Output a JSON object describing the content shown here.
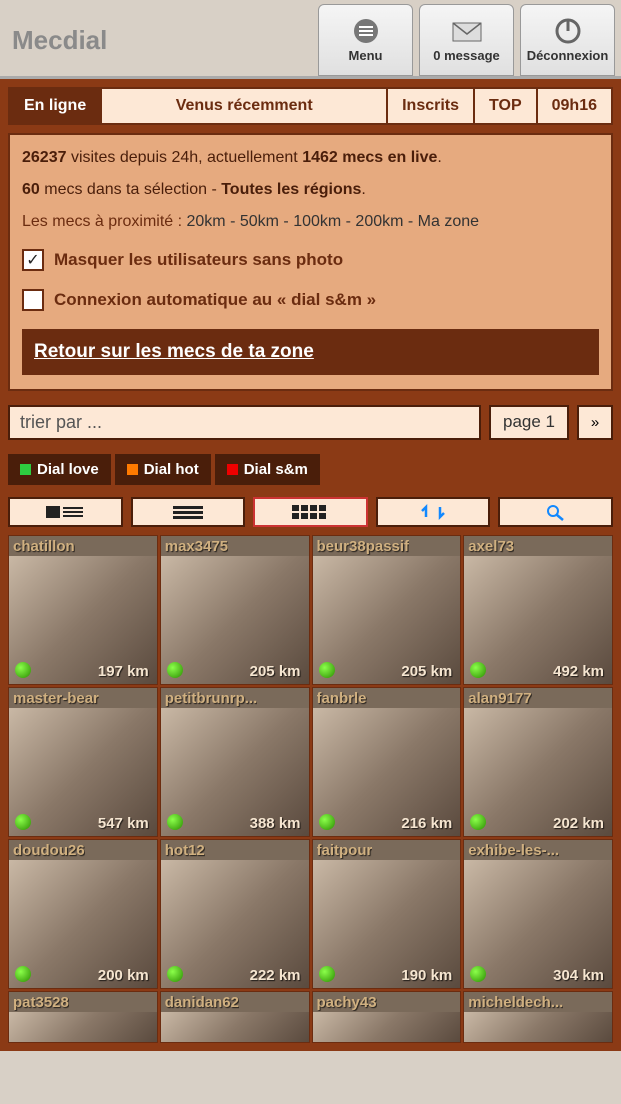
{
  "brand": "Mecdial",
  "header": {
    "menu_label": "Menu",
    "messages_label": "0 message",
    "logout_label": "Déconnexion"
  },
  "tabs": {
    "online": "En ligne",
    "recent": "Venus récemment",
    "registered": "Inscrits",
    "top": "TOP",
    "time": "09h16"
  },
  "stats": {
    "visits_count": "26237",
    "visits_text": " visites depuis 24h, actuellement ",
    "live_count": "1462",
    "live_text": " mecs en live",
    "selection_count": "60",
    "selection_text": " mecs dans ta sélection - ",
    "region": "Toutes les régions",
    "proximity_label": "Les mecs à proximité : ",
    "proximity_options": "20km - 50km - 100km - 200km - Ma zone"
  },
  "checkboxes": {
    "hide_no_photo": "Masquer les utilisateurs sans photo",
    "auto_connect": "Connexion automatique au « dial s&m »"
  },
  "return_link": "Retour sur les mecs de ta zone",
  "sort": {
    "placeholder": "trier par ...",
    "page": "page 1",
    "next": "»"
  },
  "dials": {
    "love": "Dial love",
    "hot": "Dial hot",
    "sm": "Dial s&m"
  },
  "profiles": [
    {
      "name": "chatillon",
      "distance": "197 km"
    },
    {
      "name": "max3475",
      "distance": "205 km"
    },
    {
      "name": "beur38passif",
      "distance": "205 km"
    },
    {
      "name": "axel73",
      "distance": "492 km"
    },
    {
      "name": "master-bear",
      "distance": "547 km"
    },
    {
      "name": "petitbrunrp...",
      "distance": "388 km"
    },
    {
      "name": "fanbrle",
      "distance": "216 km"
    },
    {
      "name": "alan9177",
      "distance": "202 km"
    },
    {
      "name": "doudou26",
      "distance": "200 km"
    },
    {
      "name": "hot12",
      "distance": "222 km"
    },
    {
      "name": "faitpour",
      "distance": "190 km"
    },
    {
      "name": "exhibe-les-...",
      "distance": "304 km"
    },
    {
      "name": "pat3528",
      "distance": ""
    },
    {
      "name": "danidan62",
      "distance": ""
    },
    {
      "name": "pachy43",
      "distance": ""
    },
    {
      "name": "micheldech...",
      "distance": ""
    }
  ]
}
